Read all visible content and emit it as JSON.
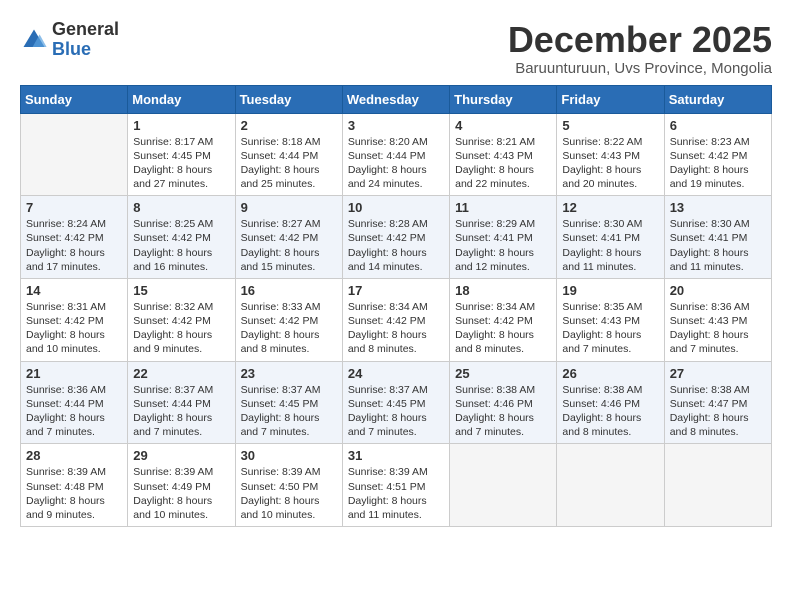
{
  "header": {
    "logo_general": "General",
    "logo_blue": "Blue",
    "month_title": "December 2025",
    "subtitle": "Baruunturuun, Uvs Province, Mongolia"
  },
  "days_of_week": [
    "Sunday",
    "Monday",
    "Tuesday",
    "Wednesday",
    "Thursday",
    "Friday",
    "Saturday"
  ],
  "weeks": [
    [
      {
        "day": "",
        "info": ""
      },
      {
        "day": "1",
        "info": "Sunrise: 8:17 AM\nSunset: 4:45 PM\nDaylight: 8 hours\nand 27 minutes."
      },
      {
        "day": "2",
        "info": "Sunrise: 8:18 AM\nSunset: 4:44 PM\nDaylight: 8 hours\nand 25 minutes."
      },
      {
        "day": "3",
        "info": "Sunrise: 8:20 AM\nSunset: 4:44 PM\nDaylight: 8 hours\nand 24 minutes."
      },
      {
        "day": "4",
        "info": "Sunrise: 8:21 AM\nSunset: 4:43 PM\nDaylight: 8 hours\nand 22 minutes."
      },
      {
        "day": "5",
        "info": "Sunrise: 8:22 AM\nSunset: 4:43 PM\nDaylight: 8 hours\nand 20 minutes."
      },
      {
        "day": "6",
        "info": "Sunrise: 8:23 AM\nSunset: 4:42 PM\nDaylight: 8 hours\nand 19 minutes."
      }
    ],
    [
      {
        "day": "7",
        "info": "Sunrise: 8:24 AM\nSunset: 4:42 PM\nDaylight: 8 hours\nand 17 minutes."
      },
      {
        "day": "8",
        "info": "Sunrise: 8:25 AM\nSunset: 4:42 PM\nDaylight: 8 hours\nand 16 minutes."
      },
      {
        "day": "9",
        "info": "Sunrise: 8:27 AM\nSunset: 4:42 PM\nDaylight: 8 hours\nand 15 minutes."
      },
      {
        "day": "10",
        "info": "Sunrise: 8:28 AM\nSunset: 4:42 PM\nDaylight: 8 hours\nand 14 minutes."
      },
      {
        "day": "11",
        "info": "Sunrise: 8:29 AM\nSunset: 4:41 PM\nDaylight: 8 hours\nand 12 minutes."
      },
      {
        "day": "12",
        "info": "Sunrise: 8:30 AM\nSunset: 4:41 PM\nDaylight: 8 hours\nand 11 minutes."
      },
      {
        "day": "13",
        "info": "Sunrise: 8:30 AM\nSunset: 4:41 PM\nDaylight: 8 hours\nand 11 minutes."
      }
    ],
    [
      {
        "day": "14",
        "info": "Sunrise: 8:31 AM\nSunset: 4:42 PM\nDaylight: 8 hours\nand 10 minutes."
      },
      {
        "day": "15",
        "info": "Sunrise: 8:32 AM\nSunset: 4:42 PM\nDaylight: 8 hours\nand 9 minutes."
      },
      {
        "day": "16",
        "info": "Sunrise: 8:33 AM\nSunset: 4:42 PM\nDaylight: 8 hours\nand 8 minutes."
      },
      {
        "day": "17",
        "info": "Sunrise: 8:34 AM\nSunset: 4:42 PM\nDaylight: 8 hours\nand 8 minutes."
      },
      {
        "day": "18",
        "info": "Sunrise: 8:34 AM\nSunset: 4:42 PM\nDaylight: 8 hours\nand 8 minutes."
      },
      {
        "day": "19",
        "info": "Sunrise: 8:35 AM\nSunset: 4:43 PM\nDaylight: 8 hours\nand 7 minutes."
      },
      {
        "day": "20",
        "info": "Sunrise: 8:36 AM\nSunset: 4:43 PM\nDaylight: 8 hours\nand 7 minutes."
      }
    ],
    [
      {
        "day": "21",
        "info": "Sunrise: 8:36 AM\nSunset: 4:44 PM\nDaylight: 8 hours\nand 7 minutes."
      },
      {
        "day": "22",
        "info": "Sunrise: 8:37 AM\nSunset: 4:44 PM\nDaylight: 8 hours\nand 7 minutes."
      },
      {
        "day": "23",
        "info": "Sunrise: 8:37 AM\nSunset: 4:45 PM\nDaylight: 8 hours\nand 7 minutes."
      },
      {
        "day": "24",
        "info": "Sunrise: 8:37 AM\nSunset: 4:45 PM\nDaylight: 8 hours\nand 7 minutes."
      },
      {
        "day": "25",
        "info": "Sunrise: 8:38 AM\nSunset: 4:46 PM\nDaylight: 8 hours\nand 7 minutes."
      },
      {
        "day": "26",
        "info": "Sunrise: 8:38 AM\nSunset: 4:46 PM\nDaylight: 8 hours\nand 8 minutes."
      },
      {
        "day": "27",
        "info": "Sunrise: 8:38 AM\nSunset: 4:47 PM\nDaylight: 8 hours\nand 8 minutes."
      }
    ],
    [
      {
        "day": "28",
        "info": "Sunrise: 8:39 AM\nSunset: 4:48 PM\nDaylight: 8 hours\nand 9 minutes."
      },
      {
        "day": "29",
        "info": "Sunrise: 8:39 AM\nSunset: 4:49 PM\nDaylight: 8 hours\nand 10 minutes."
      },
      {
        "day": "30",
        "info": "Sunrise: 8:39 AM\nSunset: 4:50 PM\nDaylight: 8 hours\nand 10 minutes."
      },
      {
        "day": "31",
        "info": "Sunrise: 8:39 AM\nSunset: 4:51 PM\nDaylight: 8 hours\nand 11 minutes."
      },
      {
        "day": "",
        "info": ""
      },
      {
        "day": "",
        "info": ""
      },
      {
        "day": "",
        "info": ""
      }
    ]
  ]
}
